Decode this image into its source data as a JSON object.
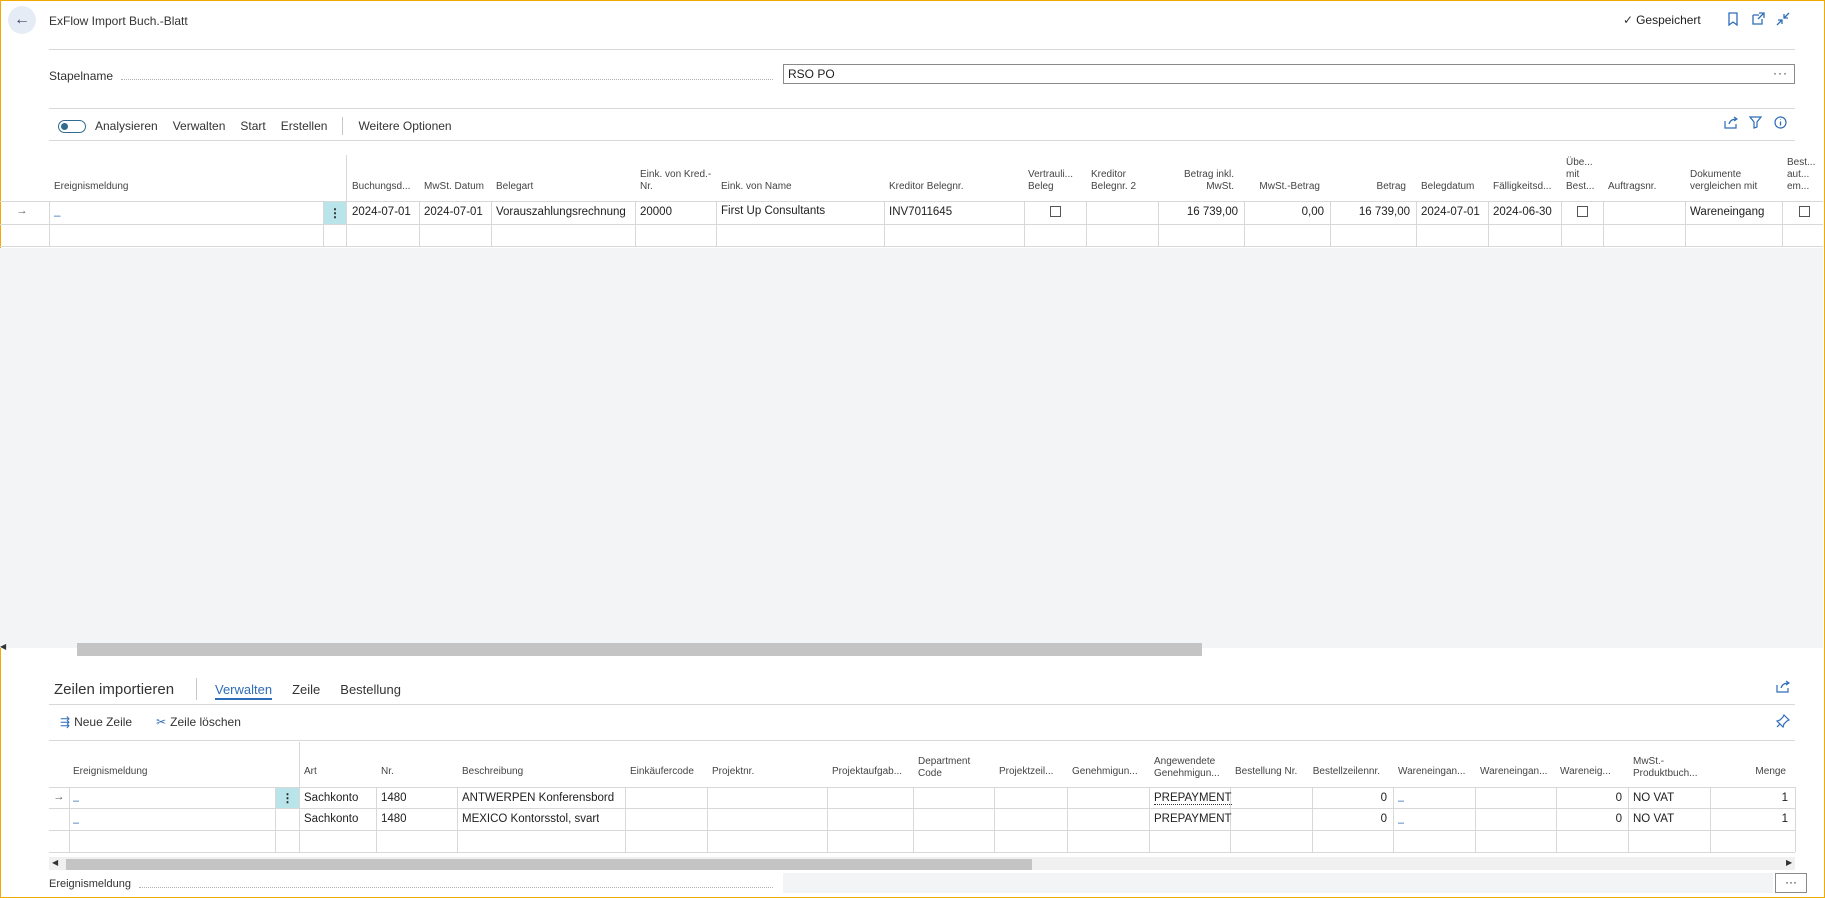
{
  "header": {
    "title": "ExFlow Import Buch.-Blatt",
    "saved": "Gespeichert"
  },
  "batch": {
    "label": "Stapelname",
    "value": "RSO PO"
  },
  "toolbar": {
    "analyze": "Analysieren",
    "manage": "Verwalten",
    "start": "Start",
    "create": "Erstellen",
    "more": "Weitere Optionen"
  },
  "main_grid": {
    "columns": [
      "Ereignismeldung",
      "Buchungsd...",
      "MwSt. Datum",
      "Belegart",
      "Eink. von Kred.-Nr.",
      "Eink. von Name",
      "Kreditor Belegnr.",
      "Vertrauli... Beleg",
      "Kreditor Belegnr. 2",
      "Betrag inkl. MwSt.",
      "MwSt.-Betrag",
      "Betrag",
      "Belegdatum",
      "Fälligkeitsd...",
      "Übe... mit Best...",
      "Auftragsnr.",
      "Dokumente vergleichen mit",
      "Best... aut... em..."
    ],
    "rows": [
      {
        "event": "_",
        "posting_date": "2024-07-01",
        "vat_date": "2024-07-01",
        "doc_type": "Vorauszahlungsrechnung",
        "vendor_no": "20000",
        "vendor_name": "First Up Consultants",
        "vendor_doc_no": "INV7011645",
        "amount_incl_vat": "16 739,00",
        "vat_amount": "0,00",
        "amount": "16 739,00",
        "doc_date": "2024-07-01",
        "due_date": "2024-06-30",
        "compare_with": "Wareneingang"
      }
    ]
  },
  "lines": {
    "title": "Zeilen importieren",
    "tabs": [
      "Verwalten",
      "Zeile",
      "Bestellung"
    ],
    "new_line": "Neue Zeile",
    "delete_line": "Zeile löschen",
    "columns": [
      "Ereignismeldung",
      "Art",
      "Nr.",
      "Beschreibung",
      "Einkäufercode",
      "Projektnr.",
      "Projektaufgab...",
      "Department Code",
      "Projektzeil...",
      "Genehmigun...",
      "Angewendete Genehmigun...",
      "Bestellung Nr.",
      "Bestellzeilennr.",
      "Wareneingan...",
      "Wareneingan...",
      "Wareneig...",
      "MwSt.-Produktbuch...",
      "Menge"
    ],
    "rows": [
      {
        "event": "_",
        "type": "Sachkonto",
        "no": "1480",
        "desc": "ANTWERPEN Konferensbord",
        "approval": "PREPAYMENT",
        "line_no": "0",
        "receipt": "_",
        "rcpt_qty": "0",
        "vat": "NO VAT",
        "qty": "1"
      },
      {
        "event": "_",
        "type": "Sachkonto",
        "no": "1480",
        "desc": "MEXICO Kontorsstol, svart",
        "approval": "PREPAYMENT",
        "line_no": "0",
        "receipt": "_",
        "rcpt_qty": "0",
        "vat": "NO VAT",
        "qty": "1"
      }
    ]
  },
  "footer": {
    "label": "Ereignismeldung"
  }
}
